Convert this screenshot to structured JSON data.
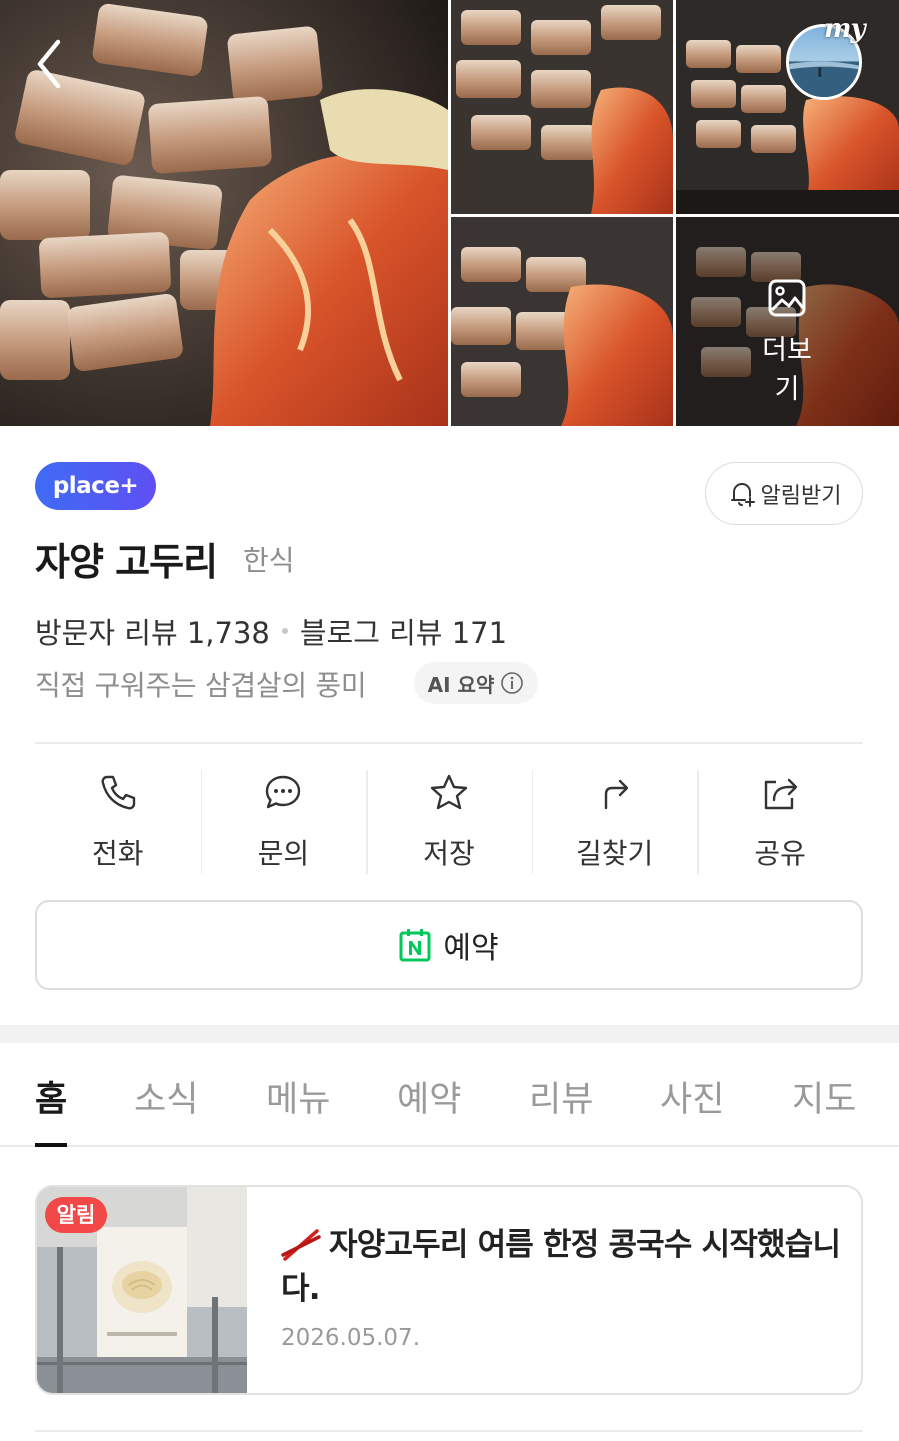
{
  "gallery": {
    "more_label": "더보기",
    "my_badge": "my"
  },
  "place": {
    "badge": "place+",
    "name": "자양 고두리",
    "category": "한식",
    "visitor_reviews": "방문자 리뷰 1,738",
    "blog_reviews": "블로그 리뷰 171",
    "summary": "직접 구워주는 삼겹살의 풍미",
    "ai_summary_label": "AI 요약"
  },
  "notify_button": {
    "label": "알림받기",
    "icon": "bell-plus-icon"
  },
  "actions": [
    {
      "label": "전화",
      "icon": "phone-icon"
    },
    {
      "label": "문의",
      "icon": "chat-bubble-icon"
    },
    {
      "label": "저장",
      "icon": "star-icon"
    },
    {
      "label": "길찾기",
      "icon": "directions-icon"
    },
    {
      "label": "공유",
      "icon": "share-icon"
    }
  ],
  "reserve_button": {
    "label": "예약",
    "icon": "naver-calendar-icon"
  },
  "tabs": [
    {
      "label": "홈",
      "active": true
    },
    {
      "label": "소식"
    },
    {
      "label": "메뉴"
    },
    {
      "label": "예약"
    },
    {
      "label": "리뷰"
    },
    {
      "label": "사진"
    },
    {
      "label": "지도"
    }
  ],
  "news": {
    "badge": "알림",
    "title": "자양고두리 여름 한정 콩국수 시작했습니다.",
    "date": "2026.05.07."
  },
  "colors": {
    "place_plus_start": "#3f6cf5",
    "place_plus_end": "#5f4ff3",
    "naver_green": "#03c75a",
    "alert_red": "#f24848"
  }
}
